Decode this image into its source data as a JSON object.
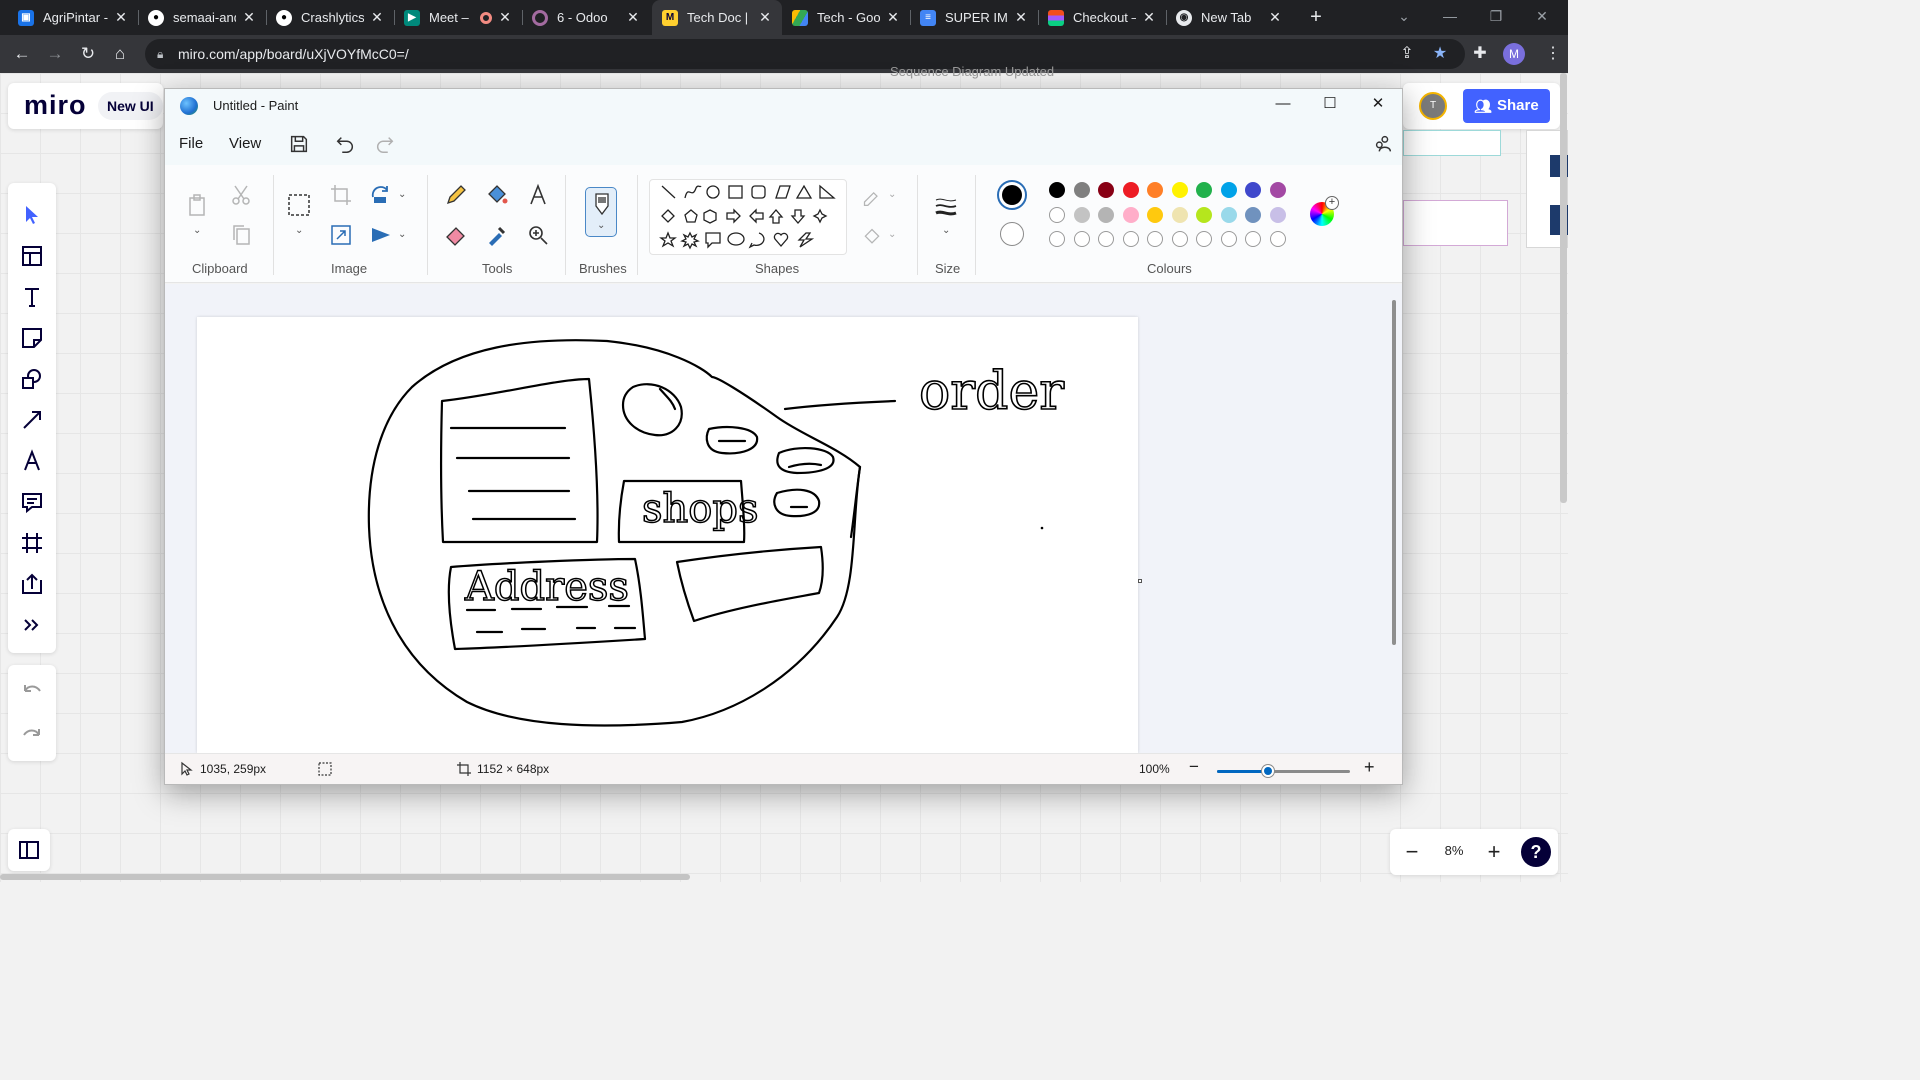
{
  "browser": {
    "tabs": [
      {
        "title": "AgriPintar -",
        "favicon": "agripintar-icon",
        "color": "#1a73e8"
      },
      {
        "title": "semaai-and",
        "favicon": "github-icon",
        "color": "#ffffff"
      },
      {
        "title": "Crashlytics",
        "favicon": "github-icon",
        "color": "#ffffff"
      },
      {
        "title": "Meet –",
        "favicon": "google-meet-icon",
        "color": "#00897b",
        "recording": true
      },
      {
        "title": "6 - Odoo",
        "favicon": "odoo-icon",
        "color": "#875a7b"
      },
      {
        "title": "Tech Doc | F",
        "favicon": "miro-icon",
        "color": "#ffd02f",
        "active": true
      },
      {
        "title": "Tech - Goo",
        "favicon": "google-drive-icon",
        "color": "#34a853"
      },
      {
        "title": "SUPER IMP",
        "favicon": "google-docs-icon",
        "color": "#4285f4"
      },
      {
        "title": "Checkout –",
        "favicon": "figma-icon",
        "color": "#f24e1e"
      },
      {
        "title": "New Tab",
        "favicon": "chrome-icon",
        "color": "#e8eaed"
      }
    ],
    "url": "miro.com/app/board/uXjVOYfMcC0=/",
    "profile_initial": "M"
  },
  "miro": {
    "logo": "miro",
    "new_ui_label": "New UI",
    "canvas_title": "Sequence Diagram Updated",
    "avatar_initial": "T",
    "share_label": "Share",
    "zoom": "8%",
    "help": "?",
    "left_tools": [
      "select-icon",
      "templates-icon",
      "text-icon",
      "sticky-note-icon",
      "shapes-icon",
      "arrow-line-icon",
      "pen-icon",
      "comment-icon",
      "frame-icon",
      "upload-icon",
      "more-tools-icon"
    ]
  },
  "paint": {
    "title": "Untitled - Paint",
    "menu": {
      "file": "File",
      "view": "View"
    },
    "groups": {
      "clipboard": "Clipboard",
      "image": "Image",
      "tools": "Tools",
      "brushes": "Brushes",
      "shapes": "Shapes",
      "size": "Size",
      "colours": "Colours"
    },
    "current_colors": {
      "primary": "#000000",
      "secondary": "#ffffff"
    },
    "palette_row1": [
      "#000000",
      "#7f7f7f",
      "#880015",
      "#ed1c24",
      "#ff7f27",
      "#fff200",
      "#22b14c",
      "#00a2e8",
      "#3f48cc",
      "#a349a4"
    ],
    "palette_row2": [
      "#ffffff",
      "#c3c3c3",
      "#b4b4b4",
      "#ffaec9",
      "#ffc90e",
      "#efe4b0",
      "#b5e61d",
      "#99d9ea",
      "#7092be",
      "#c8bfe7"
    ],
    "status": {
      "cursor": "1035, 259px",
      "canvas_size": "1152 × 648px",
      "zoom": "100%",
      "zoom_fraction": 0.38
    },
    "drawing_labels": {
      "order": "order",
      "shops": "shops",
      "address": "Address"
    }
  }
}
